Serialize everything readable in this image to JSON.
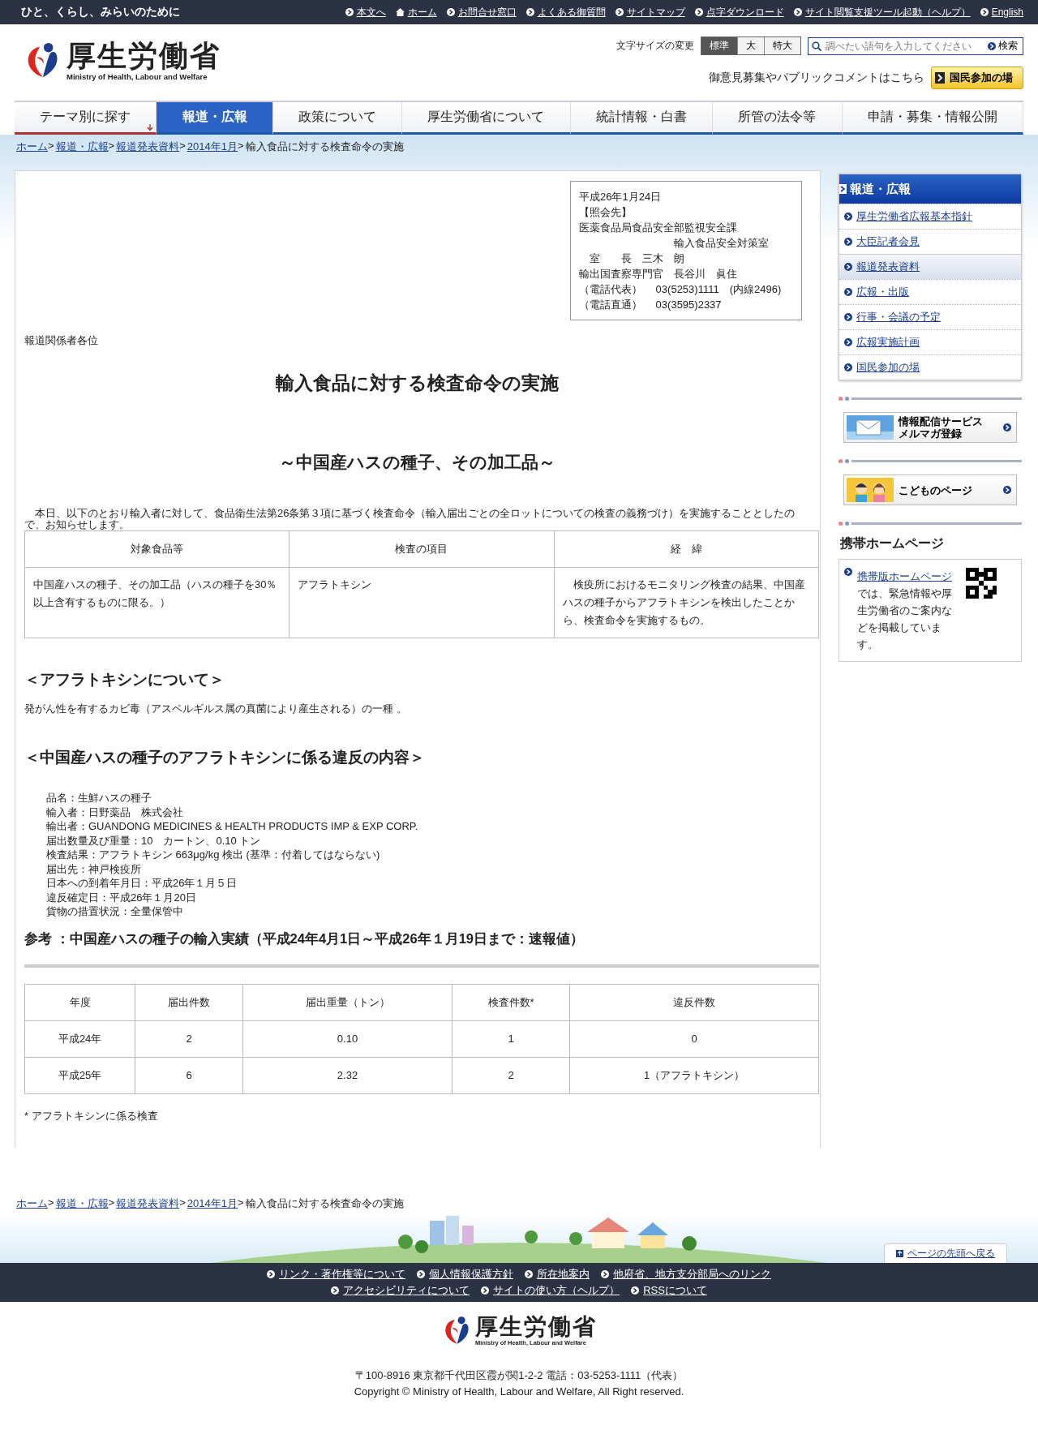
{
  "top_bar": {
    "tagline": "ひと、くらし、みらいのために",
    "links": [
      {
        "label": "本文へ",
        "kind": "bullet"
      },
      {
        "label": "ホーム",
        "kind": "home"
      },
      {
        "label": "お問合せ窓口",
        "kind": "bullet"
      },
      {
        "label": "よくある御質問",
        "kind": "bullet"
      },
      {
        "label": "サイトマップ",
        "kind": "bullet"
      },
      {
        "label": "点字ダウンロード",
        "kind": "bullet"
      },
      {
        "label": "サイト閲覧支援ツール起動（ヘルプ）",
        "kind": "bullet"
      },
      {
        "label": "English",
        "kind": "bullet"
      }
    ]
  },
  "header": {
    "logo": {
      "name": "厚生労働省",
      "subtitle": "Ministry of Health, Labour and Welfare"
    },
    "font_size": {
      "label": "文字サイズの変更",
      "options": [
        {
          "label": "標準",
          "selected": true
        },
        {
          "label": "大",
          "selected": false
        },
        {
          "label": "特大",
          "selected": false
        }
      ]
    },
    "search": {
      "placeholder": "調べたい語句を入力してください",
      "button": "検索"
    },
    "participation": {
      "text": "御意見募集やパブリックコメントはこちら",
      "button": "国民参加の場"
    }
  },
  "nav": [
    {
      "label": "テーマ別に探す",
      "kind": "dropdown",
      "selected": false
    },
    {
      "label": "報道・広報",
      "kind": "link",
      "selected": true
    },
    {
      "label": "政策について",
      "kind": "link",
      "selected": false
    },
    {
      "label": "厚生労働省について",
      "kind": "link",
      "selected": false
    },
    {
      "label": "統計情報・白書",
      "kind": "link",
      "selected": false
    },
    {
      "label": "所管の法令等",
      "kind": "link",
      "selected": false
    },
    {
      "label": "申請・募集・情報公開",
      "kind": "link",
      "selected": false
    }
  ],
  "breadcrumb": {
    "separator": ">",
    "items": [
      {
        "label": "ホーム",
        "kind": "link"
      },
      {
        "label": "報道・広報",
        "kind": "link"
      },
      {
        "label": "報道発表資料",
        "kind": "link"
      },
      {
        "label": "2014年1月",
        "kind": "link"
      },
      {
        "label": "輸入食品に対する検査命令の実施",
        "kind": "current"
      }
    ]
  },
  "article": {
    "contact_lines": [
      "平成26年1月24日",
      "【照会先】",
      "医薬食品局食品安全部監視安全課",
      "　　　　　　　　　輸入食品安全対策室",
      "　室　　長　三木　朗",
      "輸出国査察専門官　長谷川　眞住",
      "（電話代表）　 03(5253)1111　(内線2496)",
      "（電話直通）　 03(3595)2337"
    ],
    "addressee": "報道関係者各位",
    "title": "輸入食品に対する検査命令の実施",
    "subtitle": "～中国産ハスの種子、その加工品～",
    "intro": "　本日、以下のとおり輸入者に対して、食品衛生法第26条第３項に基づく検査命令（輸入届出ごとの全ロットについての検査の義務づけ）を実施することとしたので、お知らせします。",
    "order_table": {
      "columns": [
        "対象食品等",
        "検査の項目",
        "経　緯"
      ],
      "rows": [
        [
          "中国産ハスの種子、その加工品（ハスの種子を30％以上含有するものに限る。）",
          "アフラトキシン",
          "　検疫所におけるモニタリング検査の結果、中国産ハスの種子からアフラトキシンを検出したことから、検査命令を実施するもの。"
        ]
      ]
    },
    "about_heading": "＜アフラトキシンについて＞",
    "about_text": "発がん性を有するカビ毒（アスペルギルス属の真菌により産生される）の一種 。",
    "violation_heading": "＜中国産ハスの種子のアフラトキシンに係る違反の内容＞",
    "violation_lines": [
      "品名：生鮮ハスの種子",
      "輸入者：日野薬品　株式会社",
      "輸出者：GUANDONG MEDICINES & HEALTH PRODUCTS IMP & EXP CORP.",
      "届出数量及び重量：10　カートン、0.10 トン",
      "検査結果：アフラトキシン 663μg/kg 検出 (基準：付着してはならない)",
      "届出先：神戸検疫所",
      "日本への到着年月日：平成26年１月５日",
      "違反確定日：平成26年１月20日",
      "貨物の措置状況：全量保管中"
    ],
    "reference_heading": "参考 ：中国産ハスの種子の輸入実績（平成24年4月1日～平成26年１月19日まで：速報値）",
    "import_table": {
      "columns": [
        "年度",
        "届出件数",
        "届出重量（トン）",
        "検査件数*",
        "違反件数"
      ],
      "rows": [
        [
          "平成24年",
          "2",
          "0.10",
          "1",
          "0"
        ],
        [
          "平成25年",
          "6",
          "2.32",
          "2",
          "1（アフラトキシン）"
        ]
      ]
    },
    "footnote": "* アフラトキシンに係る検査"
  },
  "sidebar": {
    "heading": "報道・広報",
    "items": [
      {
        "label": "厚生労働省広報基本指針",
        "selected": false
      },
      {
        "label": "大臣記者会見",
        "selected": false
      },
      {
        "label": "報道発表資料",
        "selected": true
      },
      {
        "label": "広報・出版",
        "selected": false
      },
      {
        "label": "行事・会議の予定",
        "selected": false
      },
      {
        "label": "広報実施計画",
        "selected": false
      },
      {
        "label": "国民参加の場",
        "selected": false
      }
    ],
    "banners": [
      {
        "kind": "mail",
        "lines": [
          "情報配信サービス",
          "メルマガ登録"
        ]
      },
      {
        "kind": "kids",
        "lines": [
          "こどものページ"
        ]
      }
    ],
    "mobile": {
      "heading": "携帯ホームページ",
      "link": "携帯版ホームページ",
      "text": "では、緊急情報や厚生労働省のご案内などを掲載しています。"
    }
  },
  "footer": {
    "breadcrumb": {
      "separator": ">",
      "items": [
        {
          "label": "ホーム",
          "kind": "link"
        },
        {
          "label": "報道・広報",
          "kind": "link"
        },
        {
          "label": "報道発表資料",
          "kind": "link"
        },
        {
          "label": "2014年1月",
          "kind": "link"
        },
        {
          "label": "輸入食品に対する検査命令の実施",
          "kind": "current"
        }
      ]
    },
    "back_to_top": "ページの先頭へ戻る",
    "link_rows": [
      [
        "リンク・著作権等について",
        "個人情報保護方針",
        "所在地案内",
        "他府省、地方支分部局へのリンク"
      ],
      [
        "アクセシビリティについて",
        "サイトの使い方（ヘルプ）",
        "RSSについて"
      ]
    ],
    "logo": {
      "name": "厚生労働省",
      "subtitle": "Ministry of Health, Labour and Welfare"
    },
    "address": "〒100-8916 東京都千代田区霞が関1-2-2 電話：03-5253-1111（代表）",
    "copyright": "Copyright © Ministry of Health, Labour and Welfare, All Right reserved."
  }
}
